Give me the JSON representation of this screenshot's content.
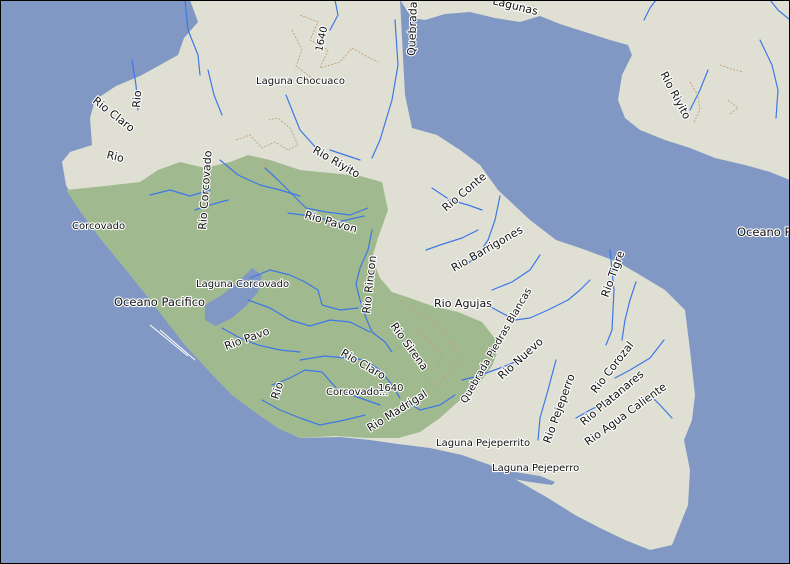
{
  "map": {
    "colors": {
      "water": "#8198c4",
      "land": "#dfe0d3",
      "park": "#a0b98e",
      "river": "#3d78e6",
      "contour": "#c2a07a",
      "frame": "#000000"
    },
    "labels": {
      "lagunas": "Lagunas",
      "quebrada_m": "Quebrada M",
      "elev_1640_north": "1640",
      "laguna_chocuaco": "Laguna Chocuaco",
      "rio_claro_nw": "Rio Claro",
      "rio_nw2": "Rio",
      "rio_nw3": "Rio",
      "rio_riyito": "Rio Riyito",
      "rio_riyito_ne": "Rio Riyito",
      "corcovado_park": "Corcovado",
      "rio_corcovado": "Rio Corcovado",
      "rio_pavon": "Rio Pavon",
      "laguna_corcovado": "Laguna Corcovado",
      "oceano_pacifico_w": "Oceano Pacifico",
      "oceano_pacifico_e": "Oceano Paci",
      "rio_conte": "Rio Conte",
      "rio_barrigones": "Rio Barrigones",
      "rio_rincon": "Rio Rincon",
      "rio_agujas": "Rio Agujas",
      "rio_tigre": "Rio Tigre",
      "rio_pavo": "Rio Pavo",
      "rio_sirena": "Rio Sirena",
      "quebrada_piedras_blancas": "Quebrada Piedras Blancas",
      "rio_claro_s": "Rio Claro",
      "elev_1640_south": "1640",
      "rio_s": "Rio",
      "corcovado_s": "Corcovado...",
      "rio_madrigal": "Rio Madrigal",
      "rio_nuevo": "Rio Nuevo",
      "rio_pejeperro": "Rio Pejeperro",
      "rio_corozal": "Rio Corozal",
      "rio_platanares": "Rio Platanares",
      "rio_agua_caliente": "Rio Agua Caliente",
      "laguna_pejeperrito": "Laguna Pejeperrito",
      "laguna_pejeperro": "Laguna Pejeperro"
    }
  }
}
